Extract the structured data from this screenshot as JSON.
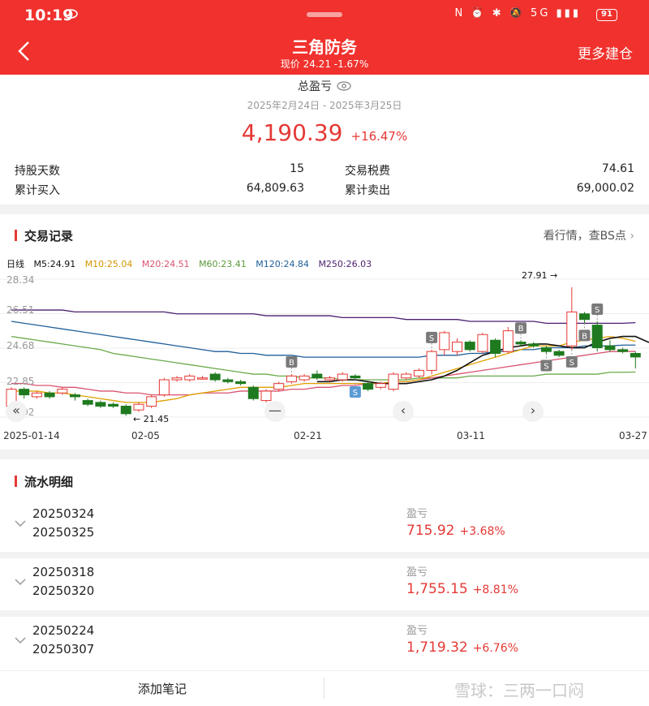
{
  "status_bar": {
    "time": "10:19",
    "icons": "N ⏰ ✱ 🔕 5G ▮▮▮",
    "battery": "91"
  },
  "header": {
    "title": "三角防务",
    "subtitle": "现价 24.21 -1.67%",
    "more_label": "更多建仓",
    "back_icon": "chevron-left-icon"
  },
  "summary": {
    "label": "总盈亏",
    "period": "2025年2月24日 - 2025年3月25日",
    "value": "4,190.39",
    "percent": "+16.47%",
    "stats": [
      {
        "label": "持股天数",
        "value": "15"
      },
      {
        "label": "交易税费",
        "value": "74.61"
      },
      {
        "label": "累计买入",
        "value": "64,809.63"
      },
      {
        "label": "累计卖出",
        "value": "69,000.02"
      }
    ]
  },
  "trade_records": {
    "title": "交易记录",
    "link": "看行情，查BS点"
  },
  "colors": {
    "accent": "#f0312d",
    "up": "#e53935",
    "down": "#1f7a1f",
    "ma5": "#111111",
    "ma10": "#e0a000",
    "ma20": "#d9536f",
    "ma60": "#6aaa4a",
    "ma120": "#1f5f99",
    "ma250": "#4b1e6e"
  },
  "chart_data": {
    "type": "candlestick",
    "period_label": "日线",
    "ma_labels": [
      "M5:24.91",
      "M10:25.04",
      "M20:24.51",
      "M60:23.41",
      "M120:24.84",
      "M250:26.03"
    ],
    "y_ticks": [
      28.34,
      26.51,
      24.68,
      22.85,
      21.02
    ],
    "y_tick_labels": [
      "28.34",
      "26.51",
      "24.68",
      "22.85",
      "21.02"
    ],
    "ylim": [
      21.02,
      28.34
    ],
    "x_labels": [
      "2025-01-14",
      "02-05",
      "02-21",
      "03-11",
      "03-27"
    ],
    "high_annotation": "27.91",
    "low_annotation": "21.45",
    "candles": [
      {
        "o": 21.6,
        "c": 22.5,
        "h": 22.6,
        "l": 21.5
      },
      {
        "o": 22.5,
        "c": 22.2,
        "h": 22.6,
        "l": 22.0
      },
      {
        "o": 22.1,
        "c": 22.3,
        "h": 22.4,
        "l": 22.0
      },
      {
        "o": 22.3,
        "c": 22.1,
        "h": 22.4,
        "l": 22.0
      },
      {
        "o": 22.3,
        "c": 22.5,
        "h": 22.6,
        "l": 22.2
      },
      {
        "o": 22.2,
        "c": 22.1,
        "h": 22.3,
        "l": 21.9
      },
      {
        "o": 21.9,
        "c": 21.7,
        "h": 22.0,
        "l": 21.6
      },
      {
        "o": 21.8,
        "c": 21.6,
        "h": 21.9,
        "l": 21.5
      },
      {
        "o": 21.7,
        "c": 21.6,
        "h": 21.8,
        "l": 21.5
      },
      {
        "o": 21.6,
        "c": 21.2,
        "h": 21.7,
        "l": 21.1
      },
      {
        "o": 21.4,
        "c": 21.7,
        "h": 21.8,
        "l": 21.3
      },
      {
        "o": 21.6,
        "c": 22.1,
        "h": 22.2,
        "l": 21.5
      },
      {
        "o": 22.2,
        "c": 23.0,
        "h": 23.1,
        "l": 22.1
      },
      {
        "o": 23.0,
        "c": 23.1,
        "h": 23.2,
        "l": 22.9
      },
      {
        "o": 23.0,
        "c": 23.2,
        "h": 23.3,
        "l": 22.9
      },
      {
        "o": 23.1,
        "c": 23.1,
        "h": 23.2,
        "l": 23.0
      },
      {
        "o": 23.3,
        "c": 23.0,
        "h": 23.4,
        "l": 22.9
      },
      {
        "o": 23.0,
        "c": 22.9,
        "h": 23.1,
        "l": 22.8
      },
      {
        "o": 22.9,
        "c": 22.8,
        "h": 23.0,
        "l": 22.7
      },
      {
        "o": 22.6,
        "c": 22.0,
        "h": 22.7,
        "l": 21.9
      },
      {
        "o": 21.9,
        "c": 22.4,
        "h": 22.5,
        "l": 21.8
      },
      {
        "o": 22.5,
        "c": 22.8,
        "h": 22.9,
        "l": 22.4
      },
      {
        "o": 22.9,
        "c": 23.2,
        "h": 23.3,
        "l": 22.8
      },
      {
        "o": 23.0,
        "c": 23.2,
        "h": 23.3,
        "l": 22.9
      },
      {
        "o": 23.3,
        "c": 23.1,
        "h": 23.5,
        "l": 23.0
      },
      {
        "o": 23.0,
        "c": 23.1,
        "h": 23.2,
        "l": 22.9
      },
      {
        "o": 23.0,
        "c": 23.3,
        "h": 23.4,
        "l": 22.9
      },
      {
        "o": 23.2,
        "c": 23.1,
        "h": 23.3,
        "l": 23.0
      },
      {
        "o": 22.8,
        "c": 22.5,
        "h": 22.9,
        "l": 22.4
      },
      {
        "o": 22.6,
        "c": 22.8,
        "h": 22.9,
        "l": 22.5
      },
      {
        "o": 22.5,
        "c": 23.3,
        "h": 23.4,
        "l": 22.4
      },
      {
        "o": 23.1,
        "c": 23.3,
        "h": 23.4,
        "l": 23.0
      },
      {
        "o": 23.2,
        "c": 23.5,
        "h": 23.6,
        "l": 23.1
      },
      {
        "o": 23.5,
        "c": 24.5,
        "h": 24.6,
        "l": 23.3
      },
      {
        "o": 24.6,
        "c": 25.5,
        "h": 25.6,
        "l": 24.3
      },
      {
        "o": 24.5,
        "c": 25.0,
        "h": 25.2,
        "l": 24.3
      },
      {
        "o": 25.0,
        "c": 24.6,
        "h": 25.1,
        "l": 24.5
      },
      {
        "o": 24.5,
        "c": 25.4,
        "h": 25.5,
        "l": 24.4
      },
      {
        "o": 25.1,
        "c": 24.4,
        "h": 25.2,
        "l": 24.2
      },
      {
        "o": 24.5,
        "c": 25.6,
        "h": 25.8,
        "l": 24.4
      },
      {
        "o": 25.0,
        "c": 24.9,
        "h": 25.1,
        "l": 24.8
      },
      {
        "o": 24.9,
        "c": 24.8,
        "h": 25.0,
        "l": 24.7
      },
      {
        "o": 24.7,
        "c": 24.5,
        "h": 24.8,
        "l": 24.4
      },
      {
        "o": 24.5,
        "c": 24.3,
        "h": 24.6,
        "l": 24.2
      },
      {
        "o": 24.8,
        "c": 26.6,
        "h": 27.91,
        "l": 24.6
      },
      {
        "o": 26.5,
        "c": 26.2,
        "h": 26.6,
        "l": 26.0
      },
      {
        "o": 25.9,
        "c": 24.7,
        "h": 26.1,
        "l": 24.5
      },
      {
        "o": 24.8,
        "c": 24.6,
        "h": 25.1,
        "l": 24.5
      },
      {
        "o": 24.6,
        "c": 24.5,
        "h": 24.7,
        "l": 24.4
      },
      {
        "o": 24.4,
        "c": 24.21,
        "h": 24.5,
        "l": 23.6
      }
    ],
    "bs_markers": [
      {
        "i": 22,
        "type": "B",
        "pos": "above"
      },
      {
        "i": 27,
        "type": "S",
        "pos": "below"
      },
      {
        "i": 33,
        "type": "S",
        "pos": "above"
      },
      {
        "i": 40,
        "type": "B",
        "pos": "above"
      },
      {
        "i": 42,
        "type": "S",
        "pos": "below"
      },
      {
        "i": 44,
        "type": "S",
        "pos": "below"
      },
      {
        "i": 45,
        "type": "B",
        "pos": "below"
      },
      {
        "i": 46,
        "type": "S",
        "pos": "above"
      }
    ],
    "ma": {
      "ma5": {
        "start": 24,
        "values": [
          22.9,
          22.9,
          23.0,
          23.0,
          22.9,
          22.8,
          22.8,
          22.8,
          22.9,
          23.0,
          23.2,
          23.5,
          23.9,
          24.3,
          24.5,
          24.7,
          24.8,
          24.9,
          24.9,
          24.8,
          24.7,
          24.7,
          25.0,
          25.2,
          25.3,
          25.3,
          25.0,
          24.9
        ]
      },
      "ma10": {
        "start": 0,
        "values": [
          22.4,
          22.4,
          22.4,
          22.3,
          22.3,
          22.2,
          22.1,
          22.0,
          21.9,
          21.8,
          21.8,
          21.8,
          21.9,
          22.0,
          22.2,
          22.3,
          22.4,
          22.5,
          22.6,
          22.6,
          22.6,
          22.6,
          22.7,
          22.8,
          22.8,
          22.8,
          22.8,
          22.8,
          22.8,
          22.8,
          22.9,
          22.9,
          23.0,
          23.2,
          23.4,
          23.6,
          23.8,
          24.0,
          24.2,
          24.4,
          24.6,
          24.8,
          24.8,
          24.8,
          25.0,
          25.1,
          25.2,
          25.3,
          25.2,
          25.04
        ]
      },
      "ma20": {
        "start": 0,
        "values": [
          22.8,
          22.8,
          22.7,
          22.7,
          22.6,
          22.6,
          22.5,
          22.4,
          22.4,
          22.3,
          22.3,
          22.2,
          22.2,
          22.2,
          22.2,
          22.3,
          22.3,
          22.3,
          22.4,
          22.4,
          22.4,
          22.4,
          22.5,
          22.5,
          22.6,
          22.6,
          22.7,
          22.7,
          22.8,
          22.8,
          22.9,
          22.9,
          23.0,
          23.1,
          23.2,
          23.3,
          23.4,
          23.5,
          23.6,
          23.7,
          23.8,
          23.9,
          24.0,
          24.1,
          24.2,
          24.3,
          24.4,
          24.5,
          24.5,
          24.51
        ]
      },
      "ma60": {
        "start": 0,
        "values": [
          25.3,
          25.2,
          25.1,
          25.0,
          24.9,
          24.8,
          24.7,
          24.6,
          24.4,
          24.3,
          24.2,
          24.1,
          24.0,
          23.9,
          23.8,
          23.7,
          23.6,
          23.5,
          23.4,
          23.3,
          23.3,
          23.2,
          23.2,
          23.1,
          23.1,
          23.1,
          23.0,
          23.0,
          23.0,
          23.0,
          23.0,
          23.0,
          23.1,
          23.1,
          23.1,
          23.1,
          23.2,
          23.2,
          23.2,
          23.2,
          23.2,
          23.2,
          23.3,
          23.3,
          23.3,
          23.3,
          23.3,
          23.4,
          23.4,
          23.41
        ]
      },
      "ma120": {
        "start": 0,
        "values": [
          26.1,
          26.0,
          25.9,
          25.8,
          25.7,
          25.6,
          25.5,
          25.4,
          25.3,
          25.2,
          25.1,
          25.0,
          24.9,
          24.8,
          24.7,
          24.6,
          24.5,
          24.5,
          24.4,
          24.4,
          24.3,
          24.3,
          24.3,
          24.2,
          24.2,
          24.2,
          24.2,
          24.2,
          24.2,
          24.2,
          24.2,
          24.2,
          24.2,
          24.3,
          24.3,
          24.3,
          24.4,
          24.4,
          24.5,
          24.5,
          24.6,
          24.6,
          24.7,
          24.7,
          24.7,
          24.8,
          24.8,
          24.8,
          24.84,
          24.84
        ]
      },
      "ma250": {
        "start": 0,
        "values": [
          26.7,
          26.7,
          26.7,
          26.7,
          26.7,
          26.6,
          26.6,
          26.6,
          26.6,
          26.6,
          26.6,
          26.6,
          26.6,
          26.5,
          26.5,
          26.5,
          26.5,
          26.5,
          26.5,
          26.5,
          26.4,
          26.4,
          26.4,
          26.4,
          26.4,
          26.4,
          26.3,
          26.3,
          26.3,
          26.3,
          26.3,
          26.2,
          26.2,
          26.2,
          26.2,
          26.2,
          26.1,
          26.1,
          26.1,
          26.1,
          26.1,
          26.1,
          26.0,
          26.0,
          26.0,
          26.0,
          26.0,
          26.0,
          26.0,
          26.03
        ]
      }
    }
  },
  "chart_controls": {
    "first": "«",
    "zoom_out": "—",
    "prev": "‹",
    "next": "›"
  },
  "flow": {
    "title": "流水明细",
    "rows": [
      {
        "d1": "20250324",
        "d2": "20250325",
        "label": "盈亏",
        "value": "715.92",
        "pct": "+3.68%"
      },
      {
        "d1": "20250318",
        "d2": "20250320",
        "label": "盈亏",
        "value": "1,755.15",
        "pct": "+8.81%"
      },
      {
        "d1": "20250224",
        "d2": "20250307",
        "label": "盈亏",
        "value": "1,719.32",
        "pct": "+6.76%"
      }
    ]
  },
  "bottom": {
    "note_button": "添加笔记",
    "watermark": "雪球：三两一口闷"
  }
}
